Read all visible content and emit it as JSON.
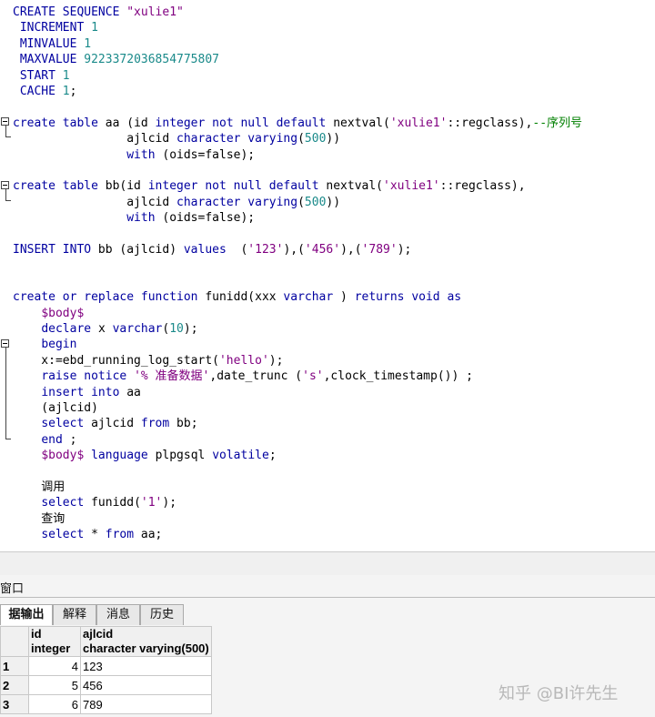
{
  "editor": {
    "lines": [
      {
        "segs": [
          [
            "kw",
            "CREATE SEQUENCE "
          ],
          [
            "str",
            "\"xulie1\""
          ]
        ]
      },
      {
        "segs": [
          [
            "kw",
            " INCREMENT "
          ],
          [
            "num",
            "1"
          ]
        ]
      },
      {
        "segs": [
          [
            "kw",
            " MINVALUE "
          ],
          [
            "num",
            "1"
          ]
        ]
      },
      {
        "segs": [
          [
            "kw",
            " MAXVALUE "
          ],
          [
            "num",
            "9223372036854775807"
          ]
        ]
      },
      {
        "segs": [
          [
            "kw",
            " START "
          ],
          [
            "num",
            "1"
          ]
        ]
      },
      {
        "segs": [
          [
            "kw",
            " CACHE "
          ],
          [
            "num",
            "1"
          ],
          [
            "fn",
            ";"
          ]
        ]
      },
      {
        "segs": []
      },
      {
        "segs": [
          [
            "kw",
            "create table "
          ],
          [
            "fn",
            "aa "
          ],
          [
            "fn",
            "("
          ],
          [
            "fn",
            "id "
          ],
          [
            "kw",
            "integer not null default "
          ],
          [
            "fn",
            "nextval("
          ],
          [
            "str",
            "'xulie1'"
          ],
          [
            "fn",
            "::regclass),"
          ],
          [
            "cm",
            "--序列号"
          ]
        ]
      },
      {
        "segs": [
          [
            "fn",
            "                "
          ],
          [
            "fn",
            "ajlcid "
          ],
          [
            "kw",
            "character varying"
          ],
          [
            "fn",
            "("
          ],
          [
            "num",
            "500"
          ],
          [
            "fn",
            "))"
          ]
        ]
      },
      {
        "segs": [
          [
            "fn",
            "                "
          ],
          [
            "kw",
            "with "
          ],
          [
            "fn",
            "(oids=false);"
          ]
        ]
      },
      {
        "segs": []
      },
      {
        "segs": [
          [
            "kw",
            "create table "
          ],
          [
            "fn",
            "bb(id "
          ],
          [
            "kw",
            "integer not null default "
          ],
          [
            "fn",
            "nextval("
          ],
          [
            "str",
            "'xulie1'"
          ],
          [
            "fn",
            "::regclass),"
          ]
        ]
      },
      {
        "segs": [
          [
            "fn",
            "                "
          ],
          [
            "fn",
            "ajlcid "
          ],
          [
            "kw",
            "character varying"
          ],
          [
            "fn",
            "("
          ],
          [
            "num",
            "500"
          ],
          [
            "fn",
            "))"
          ]
        ]
      },
      {
        "segs": [
          [
            "fn",
            "                "
          ],
          [
            "kw",
            "with "
          ],
          [
            "fn",
            "(oids=false);"
          ]
        ]
      },
      {
        "segs": []
      },
      {
        "segs": [
          [
            "kw",
            "INSERT INTO "
          ],
          [
            "fn",
            "bb (ajlcid) "
          ],
          [
            "kw",
            "values  "
          ],
          [
            "fn",
            "("
          ],
          [
            "str",
            "'123'"
          ],
          [
            "fn",
            "),("
          ],
          [
            "str",
            "'456'"
          ],
          [
            "fn",
            "),("
          ],
          [
            "str",
            "'789'"
          ],
          [
            "fn",
            ");"
          ]
        ]
      },
      {
        "segs": []
      },
      {
        "segs": []
      },
      {
        "segs": [
          [
            "kw",
            "create or replace function "
          ],
          [
            "fn",
            "funidd(xxx "
          ],
          [
            "kw",
            "varchar "
          ],
          [
            "fn",
            ") "
          ],
          [
            "kw",
            "returns void as"
          ]
        ]
      },
      {
        "segs": [
          [
            "fn",
            "    "
          ],
          [
            "cn",
            "$body$"
          ]
        ]
      },
      {
        "segs": [
          [
            "fn",
            "    "
          ],
          [
            "kw",
            "declare "
          ],
          [
            "fn",
            "x "
          ],
          [
            "kw",
            "varchar"
          ],
          [
            "fn",
            "("
          ],
          [
            "num",
            "10"
          ],
          [
            "fn",
            ");"
          ]
        ]
      },
      {
        "segs": [
          [
            "fn",
            "    "
          ],
          [
            "kw",
            "begin"
          ]
        ]
      },
      {
        "segs": [
          [
            "fn",
            "    x:=ebd_running_log_start("
          ],
          [
            "str",
            "'hello'"
          ],
          [
            "fn",
            ");"
          ]
        ]
      },
      {
        "segs": [
          [
            "fn",
            "    "
          ],
          [
            "kw",
            "raise notice "
          ],
          [
            "str",
            "'% 准备数据'"
          ],
          [
            "fn",
            ",date_trunc ("
          ],
          [
            "str",
            "'s'"
          ],
          [
            "fn",
            ",clock_timestamp()) ;"
          ]
        ]
      },
      {
        "segs": [
          [
            "fn",
            "    "
          ],
          [
            "kw",
            "insert into "
          ],
          [
            "fn",
            "aa"
          ]
        ]
      },
      {
        "segs": [
          [
            "fn",
            "    (ajlcid)"
          ]
        ]
      },
      {
        "segs": [
          [
            "fn",
            "    "
          ],
          [
            "kw",
            "select "
          ],
          [
            "fn",
            "ajlcid "
          ],
          [
            "kw",
            "from "
          ],
          [
            "fn",
            "bb;"
          ]
        ]
      },
      {
        "segs": [
          [
            "fn",
            "    "
          ],
          [
            "kw",
            "end "
          ],
          [
            "fn",
            ";"
          ]
        ]
      },
      {
        "segs": [
          [
            "fn",
            "    "
          ],
          [
            "cn",
            "$body$ "
          ],
          [
            "kw",
            "language "
          ],
          [
            "fn",
            "plpgsql "
          ],
          [
            "kw",
            "volatile"
          ],
          [
            "fn",
            ";"
          ]
        ]
      },
      {
        "segs": []
      },
      {
        "segs": [
          [
            "fn",
            "    调用"
          ]
        ]
      },
      {
        "segs": [
          [
            "fn",
            "    "
          ],
          [
            "kw",
            "select "
          ],
          [
            "fn",
            "funidd("
          ],
          [
            "str",
            "'1'"
          ],
          [
            "fn",
            ");"
          ]
        ]
      },
      {
        "segs": [
          [
            "fn",
            "    查询"
          ]
        ]
      },
      {
        "segs": [
          [
            "fn",
            "    "
          ],
          [
            "kw",
            "select "
          ],
          [
            "fn",
            "* "
          ],
          [
            "kw",
            "from "
          ],
          [
            "fn",
            "aa;"
          ]
        ]
      }
    ]
  },
  "output": {
    "title": "窗口",
    "tabs": [
      "据输出",
      "解释",
      "消息",
      "历史"
    ],
    "columns": [
      {
        "name": "id",
        "type": "integer"
      },
      {
        "name": "ajlcid",
        "type": "character varying(500)"
      }
    ],
    "rows": [
      {
        "num": "1",
        "id": "4",
        "ajlcid": "123"
      },
      {
        "num": "2",
        "id": "5",
        "ajlcid": "456"
      },
      {
        "num": "3",
        "id": "6",
        "ajlcid": "789"
      }
    ]
  },
  "watermark": "知乎 @BI许先生"
}
